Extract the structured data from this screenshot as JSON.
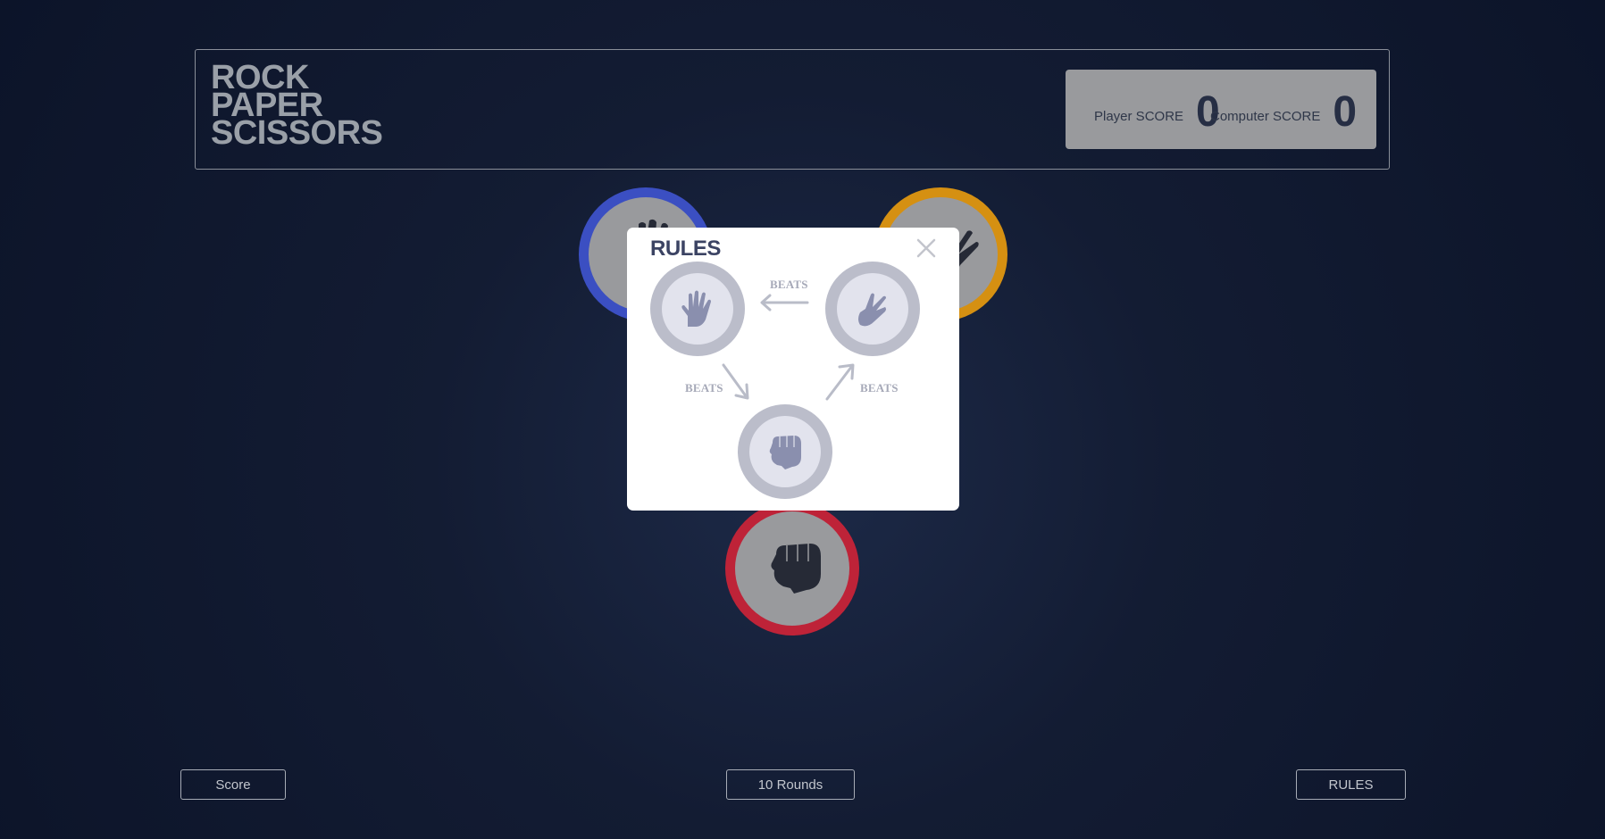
{
  "header": {
    "title_lines": [
      "ROCK",
      "PAPER",
      "SCISSORS"
    ],
    "player_label": "Player SCORE",
    "player_score": "0",
    "computer_label": "Computer SCORE",
    "computer_score": "0"
  },
  "game": {
    "choices": [
      {
        "name": "paper",
        "ring_color": "#3b4fc2",
        "icon": "hand-open-icon"
      },
      {
        "name": "scissors",
        "ring_color": "#d59012",
        "icon": "hand-peace-icon"
      },
      {
        "name": "rock",
        "ring_color": "#be2338",
        "icon": "fist-icon"
      }
    ]
  },
  "modal": {
    "title": "RULES",
    "beats_top": "BEATS",
    "beats_left": "BEATS",
    "beats_right": "BEATS",
    "close_icon": "close-icon"
  },
  "footer": {
    "score_label": "Score",
    "rounds_label": "10 Rounds",
    "rules_label": "RULES"
  },
  "colors": {
    "paper": "#3b4fc2",
    "scissors": "#d59012",
    "rock": "#be2338",
    "background": "#131c33"
  }
}
